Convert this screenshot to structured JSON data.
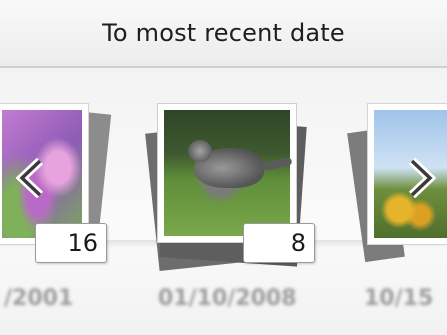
{
  "header": {
    "title": "To most recent date"
  },
  "carousel": {
    "left": {
      "count": "16",
      "date": "/2001"
    },
    "center": {
      "count": "8",
      "date": "01/10/2008"
    },
    "right": {
      "date": "10/15"
    },
    "prev_icon": "chevron-left-icon",
    "next_icon": "chevron-right-icon"
  },
  "colors": {
    "background": "#f4f4f4",
    "header": "#ececec",
    "text": "#1e1e1e",
    "date_text": "#9c9c9c"
  }
}
